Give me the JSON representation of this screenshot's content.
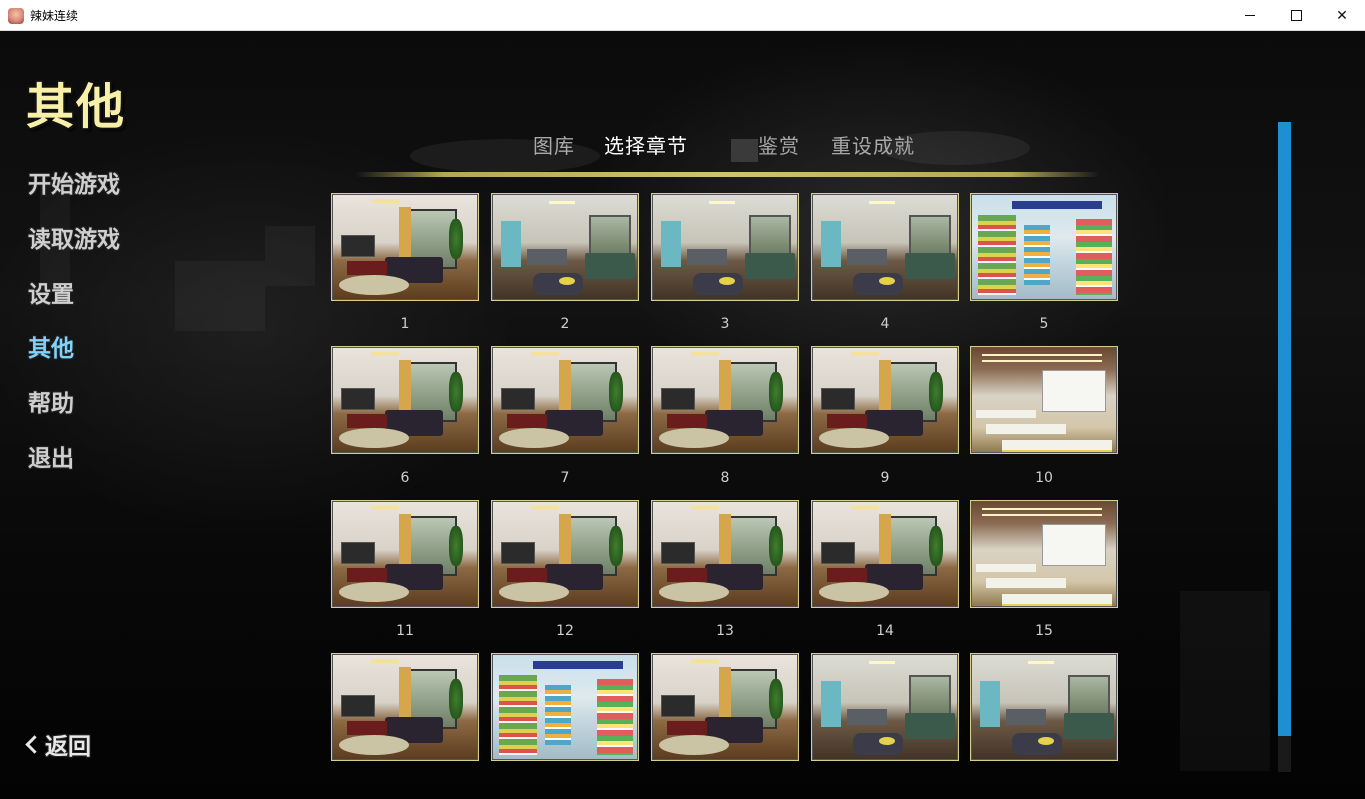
{
  "window": {
    "title": "辣妹连续",
    "min_label": "",
    "max_label": "",
    "close_label": "✕"
  },
  "sidebar": {
    "heading": "其他",
    "items": [
      {
        "label": "开始游戏",
        "active": false
      },
      {
        "label": "读取游戏",
        "active": false
      },
      {
        "label": "设置",
        "active": false
      },
      {
        "label": "其他",
        "active": true
      },
      {
        "label": "帮助",
        "active": false
      },
      {
        "label": "退出",
        "active": false
      }
    ],
    "back_label": "返回"
  },
  "tabs": [
    {
      "label": "图库",
      "active": false
    },
    {
      "label": "选择章节",
      "active": true
    },
    {
      "label": "鉴赏",
      "active": false
    },
    {
      "label": "重设成就",
      "active": false
    }
  ],
  "chapters": [
    {
      "number": "1",
      "scene": "living"
    },
    {
      "number": "2",
      "scene": "bedroom"
    },
    {
      "number": "3",
      "scene": "bedroom"
    },
    {
      "number": "4",
      "scene": "bedroom"
    },
    {
      "number": "5",
      "scene": "store"
    },
    {
      "number": "6",
      "scene": "living"
    },
    {
      "number": "7",
      "scene": "living"
    },
    {
      "number": "8",
      "scene": "living"
    },
    {
      "number": "9",
      "scene": "living"
    },
    {
      "number": "10",
      "scene": "classroom"
    },
    {
      "number": "11",
      "scene": "living"
    },
    {
      "number": "12",
      "scene": "living"
    },
    {
      "number": "13",
      "scene": "living"
    },
    {
      "number": "14",
      "scene": "living"
    },
    {
      "number": "15",
      "scene": "classroom"
    },
    {
      "number": "",
      "scene": "living"
    },
    {
      "number": "",
      "scene": "store"
    },
    {
      "number": "",
      "scene": "living"
    },
    {
      "number": "",
      "scene": "bedroom"
    },
    {
      "number": "",
      "scene": "bedroom"
    }
  ],
  "colors": {
    "heading": "#f8f0a8",
    "active_menu": "#7fd3ff",
    "scrollbar": "#1e8fd0",
    "thumb_border": "#d6cf88"
  }
}
